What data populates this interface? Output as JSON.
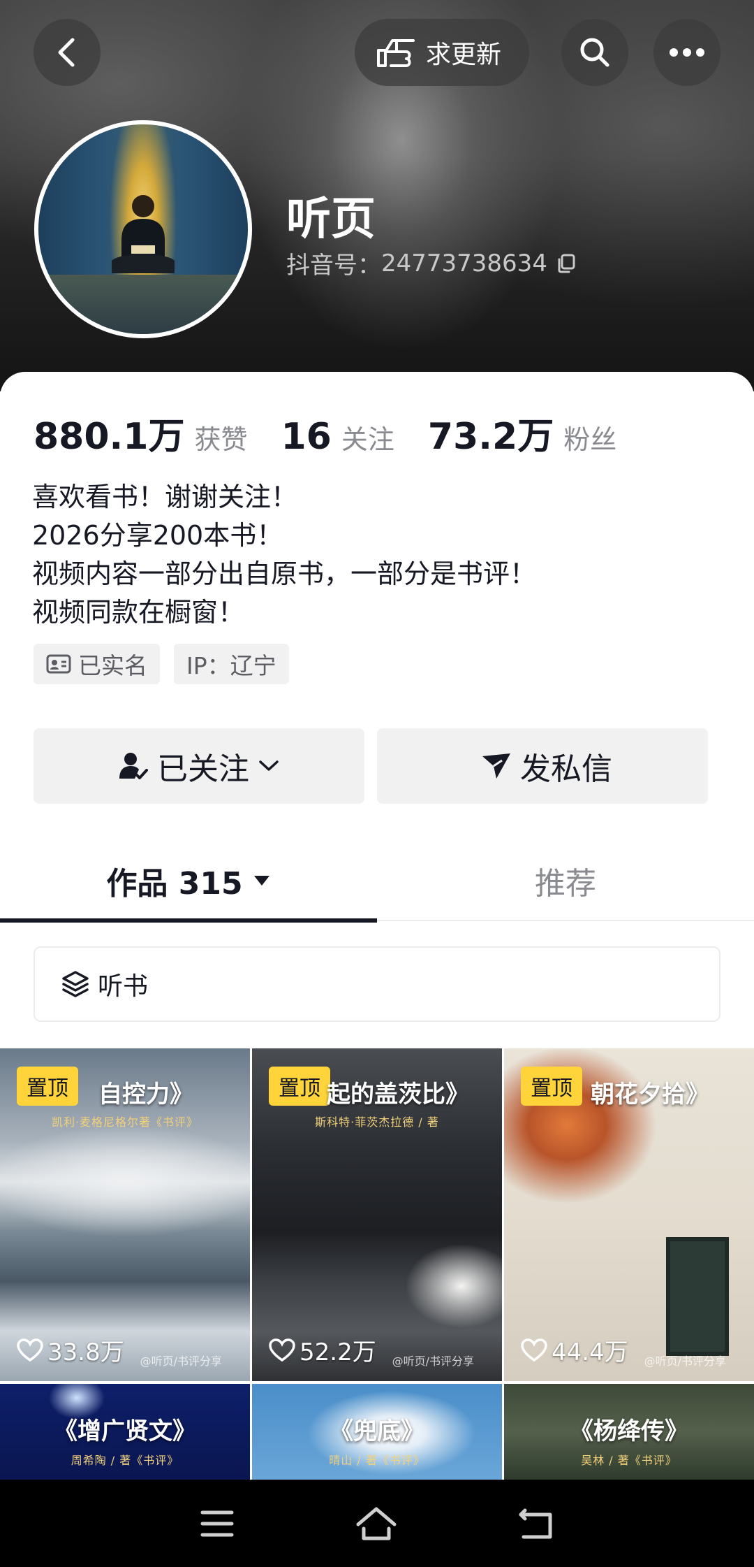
{
  "header": {
    "update_label": "求更新",
    "back_icon": "back-arrow-icon",
    "search_icon": "search-icon",
    "more_icon": "more-dots-icon"
  },
  "profile": {
    "nickname": "听页",
    "douyin_id_label": "抖音号：",
    "douyin_id": "24773738634"
  },
  "stats": [
    {
      "num": "880.1万",
      "label": "获赞"
    },
    {
      "num": "16",
      "label": "关注"
    },
    {
      "num": "73.2万",
      "label": "粉丝"
    }
  ],
  "bio": [
    "喜欢看书！谢谢关注！",
    "2026分享200本书！",
    "视频内容一部分出自原书，一部分是书评！",
    "视频同款在橱窗！"
  ],
  "tags": {
    "verified": "已实名",
    "ip": "IP：辽宁"
  },
  "actions": {
    "followed": "已关注",
    "message": "发私信"
  },
  "tabs": {
    "works": "作品 315",
    "recommend": "推荐"
  },
  "collection": {
    "label": "听书"
  },
  "videos": [
    {
      "title": "自控力》",
      "subtitle": "凯利·麦格尼格尔著《书评》",
      "pinned": "置顶",
      "likes": "33.8万",
      "watermark": "@听页/书评分享"
    },
    {
      "title": "起的盖茨比》",
      "subtitle": "斯科特·菲茨杰拉德 / 著",
      "pinned": "置顶",
      "likes": "52.2万",
      "watermark": "@听页/书评分享"
    },
    {
      "title": "朝花夕拾》",
      "subtitle": "",
      "pinned": "置顶",
      "likes": "44.4万",
      "watermark": "@听页/书评分享"
    },
    {
      "title": "《增广贤文》",
      "subtitle": "周希陶 / 著《书评》",
      "pinned": "",
      "likes": "",
      "watermark": ""
    },
    {
      "title": "《兜底》",
      "subtitle": "晴山 / 著《书评》",
      "pinned": "",
      "likes": "",
      "watermark": ""
    },
    {
      "title": "《杨绛传》",
      "subtitle": "吴林 / 著《书评》",
      "pinned": "",
      "likes": "",
      "watermark": ""
    }
  ],
  "colors": {
    "pin_bg": "#fed43a",
    "text_primary": "#161823",
    "text_secondary": "#8a8b91",
    "button_bg": "#f1f1f2"
  }
}
